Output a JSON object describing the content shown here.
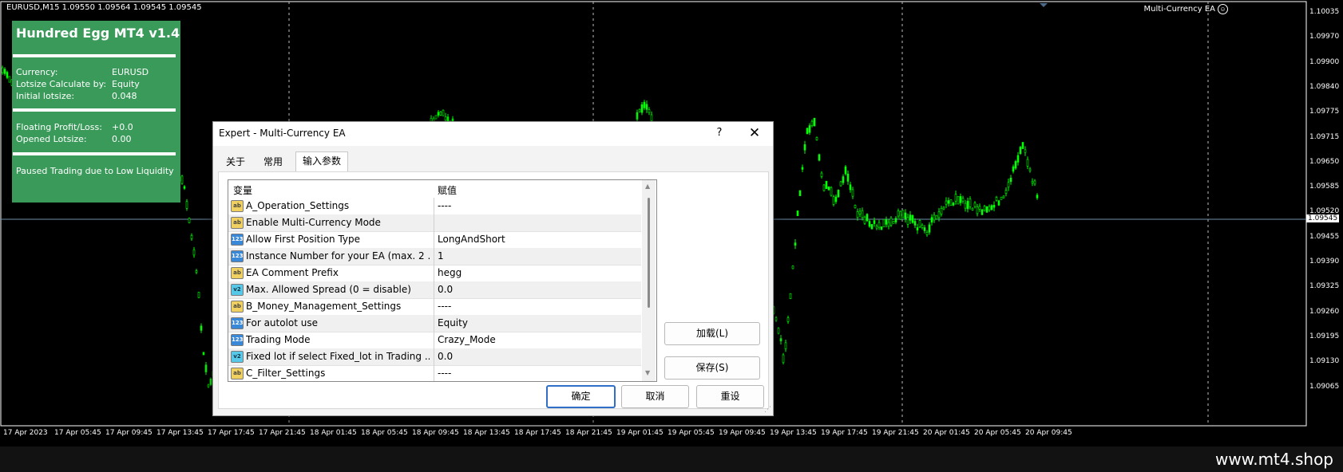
{
  "chart": {
    "symbol_info": "EURUSD,M15  1.09550 1.09564 1.09545 1.09545",
    "ea_name": "Multi-Currency EA",
    "current_price": "1.09545",
    "price_axis": [
      "1.10035",
      "1.09970",
      "1.09900",
      "1.09840",
      "1.09775",
      "1.09715",
      "1.09650",
      "1.09585",
      "1.09520",
      "1.09455",
      "1.09390",
      "1.09325",
      "1.09260",
      "1.09195",
      "1.09130",
      "1.09065"
    ],
    "time_axis": [
      "17 Apr 2023",
      "17 Apr 05:45",
      "17 Apr 09:45",
      "17 Apr 13:45",
      "17 Apr 17:45",
      "17 Apr 21:45",
      "18 Apr 01:45",
      "18 Apr 05:45",
      "18 Apr 09:45",
      "18 Apr 13:45",
      "18 Apr 17:45",
      "18 Apr 21:45",
      "19 Apr 01:45",
      "19 Apr 05:45",
      "19 Apr 09:45",
      "19 Apr 13:45",
      "19 Apr 17:45",
      "19 Apr 21:45",
      "20 Apr 01:45",
      "20 Apr 05:45",
      "20 Apr 09:45"
    ],
    "candle_color": "#00ff00"
  },
  "panel": {
    "title": "Hundred Egg MT4 v1.4",
    "currency_label": "Currency:",
    "currency_value": "EURUSD",
    "lotsize_calc_label": "Lotsize Calculate by:",
    "lotsize_calc_value": "Equity",
    "initial_lotsize_label": "Initial lotsize:",
    "initial_lotsize_value": "0.048",
    "floating_label": "Floating Profit/Loss:",
    "floating_value": "+0.0",
    "opened_label": "Opened Lotsize:",
    "opened_value": "0.00",
    "status": "Paused Trading due to Low Liquidity",
    "bg_color": "#3a9a5a"
  },
  "dialog": {
    "title": "Expert - Multi-Currency EA",
    "help": "?",
    "close": "✕",
    "tabs": [
      "关于",
      "常用",
      "输入参数"
    ],
    "active_tab": "输入参数",
    "grid_headers": {
      "variable": "变量",
      "value": "赋值"
    },
    "params": [
      {
        "icon": "ab",
        "name": "A_Operation_Settings",
        "value": "----"
      },
      {
        "icon": "ab",
        "name": "Enable Multi-Currency Mode",
        "value": ""
      },
      {
        "icon": "123",
        "name": "Allow First Position Type",
        "value": "LongAndShort"
      },
      {
        "icon": "123",
        "name": "Instance Number for your EA (max. 2 ...",
        "value": "1"
      },
      {
        "icon": "ab",
        "name": "EA Comment Prefix",
        "value": "hegg"
      },
      {
        "icon": "v2",
        "name": "Max. Allowed Spread (0 = disable)",
        "value": "0.0"
      },
      {
        "icon": "ab",
        "name": "B_Money_Management_Settings",
        "value": "----"
      },
      {
        "icon": "123",
        "name": "For autolot use",
        "value": "Equity"
      },
      {
        "icon": "123",
        "name": "Trading Mode",
        "value": "Crazy_Mode"
      },
      {
        "icon": "v2",
        "name": "Fixed lot if select Fixed_lot in Trading ...",
        "value": "0.0"
      },
      {
        "icon": "ab",
        "name": "C_Filter_Settings",
        "value": "----"
      }
    ],
    "load_button": "加载(L)",
    "save_button": "保存(S)",
    "ok_button": "确定",
    "cancel_button": "取消",
    "reset_button": "重设"
  },
  "footer": {
    "site": "www.mt4.shop"
  }
}
